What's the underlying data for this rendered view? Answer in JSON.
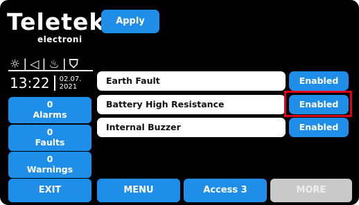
{
  "brand": {
    "name": "Teletek",
    "sub": "electroni"
  },
  "status_icons": [
    {
      "icon": "sun-icon",
      "glyph": "☼"
    },
    {
      "icon": "speaker-icon",
      "glyph": "◁"
    },
    {
      "icon": "flame-icon",
      "glyph": "♨"
    },
    {
      "icon": "extinguisher-icon",
      "glyph": "⛉"
    }
  ],
  "clock": {
    "time": "13:22",
    "date_line1": "02.07.",
    "date_line2": "2021"
  },
  "counters": {
    "alarms": {
      "count": "0",
      "label": "Alarms"
    },
    "faults": {
      "count": "0",
      "label": "Faults"
    },
    "warnings": {
      "count": "0",
      "label": "Warnings"
    }
  },
  "apply_label": "Apply",
  "rows": [
    {
      "label": "Earth Fault",
      "state": "Enabled"
    },
    {
      "label": "Battery High Resistance",
      "state": "Enabled"
    },
    {
      "label": "Internal Buzzer",
      "state": "Enabled"
    }
  ],
  "bottom": {
    "exit": "EXIT",
    "menu": "MENU",
    "access": "Access 3",
    "more": "MORE"
  },
  "colors": {
    "accent": "#1f8ee8",
    "highlight": "#e0001a",
    "disabled": "#c9c9c9",
    "background": "#000000"
  }
}
